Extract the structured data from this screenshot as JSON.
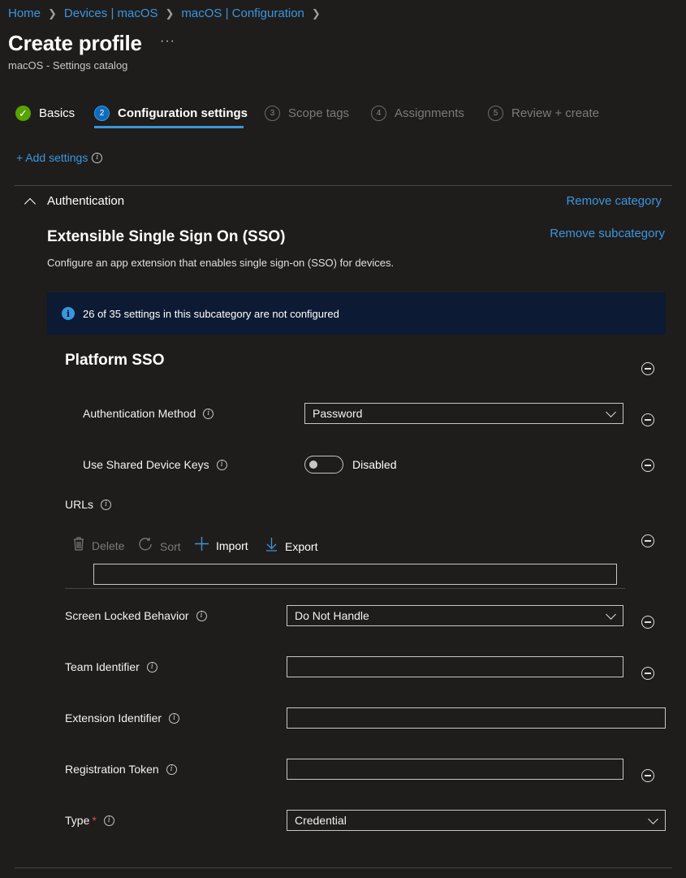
{
  "breadcrumb": [
    "Home",
    "Devices | macOS",
    "macOS | Configuration"
  ],
  "header": {
    "title": "Create profile",
    "more": "···",
    "subtitle": "macOS - Settings catalog"
  },
  "steps": [
    {
      "num": "✓",
      "label": "Basics",
      "state": "done"
    },
    {
      "num": "2",
      "label": "Configuration settings",
      "state": "current"
    },
    {
      "num": "3",
      "label": "Scope tags",
      "state": "todo"
    },
    {
      "num": "4",
      "label": "Assignments",
      "state": "todo"
    },
    {
      "num": "5",
      "label": "Review + create",
      "state": "todo"
    }
  ],
  "add_settings": "+ Add settings",
  "category": {
    "name": "Authentication",
    "remove": "Remove category"
  },
  "subcategory": {
    "title": "Extensible Single Sign On (SSO)",
    "remove": "Remove subcategory",
    "description": "Configure an app extension that enables single sign-on (SSO) for devices.",
    "banner": "26 of 35 settings in this subcategory are not configured"
  },
  "platform_sso": {
    "title": "Platform SSO",
    "auth_method": {
      "label": "Authentication Method",
      "value": "Password"
    },
    "shared_keys": {
      "label": "Use Shared Device Keys",
      "state": "Disabled"
    }
  },
  "urls": {
    "label": "URLs",
    "toolbar": {
      "delete": "Delete",
      "sort": "Sort",
      "import": "Import",
      "export": "Export"
    },
    "input_value": ""
  },
  "fields": {
    "screen_locked": {
      "label": "Screen Locked Behavior",
      "value": "Do Not Handle"
    },
    "team_id": {
      "label": "Team Identifier",
      "value": ""
    },
    "extension_id": {
      "label": "Extension Identifier",
      "value": ""
    },
    "registration_token": {
      "label": "Registration Token",
      "value": ""
    },
    "type": {
      "label": "Type",
      "required": "*",
      "value": "Credential"
    }
  },
  "colors": {
    "accent": "#3a96dd",
    "success": "#57a300",
    "background": "#1f1d1c",
    "banner": "#0c1a33"
  }
}
